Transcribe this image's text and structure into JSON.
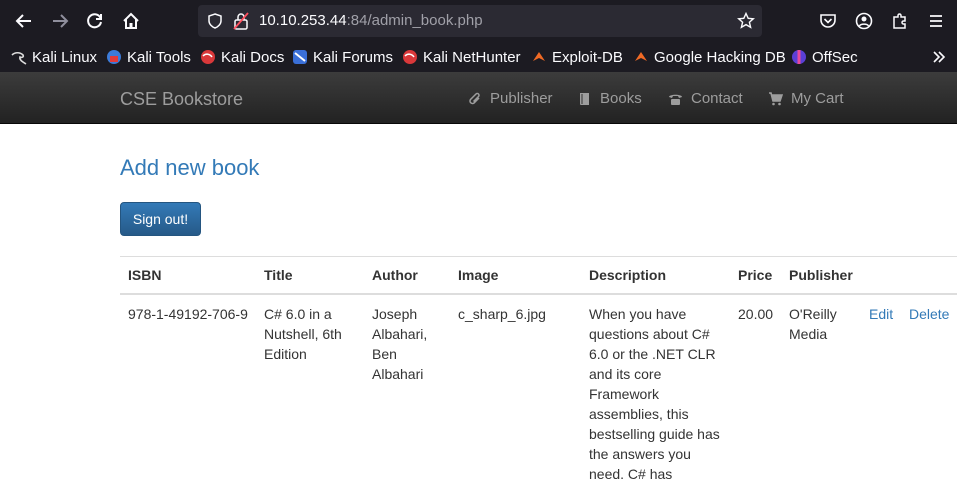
{
  "browser": {
    "url_host": "10.10.253.44",
    "url_path": ":84/admin_book.php",
    "bookmarks": [
      {
        "label": "Kali Linux",
        "icon": "kali-dragon-icon"
      },
      {
        "label": "Kali Tools",
        "icon": "kali-tools-icon"
      },
      {
        "label": "Kali Docs",
        "icon": "kali-docs-icon"
      },
      {
        "label": "Kali Forums",
        "icon": "kali-forums-icon"
      },
      {
        "label": "Kali NetHunter",
        "icon": "kali-nethunter-icon"
      },
      {
        "label": "Exploit-DB",
        "icon": "exploit-db-icon"
      },
      {
        "label": "Google Hacking DB",
        "icon": "ghdb-icon"
      },
      {
        "label": "OffSec",
        "icon": "offsec-icon"
      }
    ]
  },
  "navbar": {
    "brand": "CSE Bookstore",
    "items": [
      {
        "label": "Publisher",
        "icon": "paperclip-icon"
      },
      {
        "label": "Books",
        "icon": "book-icon"
      },
      {
        "label": "Contact",
        "icon": "phone-icon"
      },
      {
        "label": "My Cart",
        "icon": "cart-icon"
      }
    ]
  },
  "main": {
    "heading": "Add new book",
    "signout_label": "Sign out!",
    "table": {
      "headers": [
        "ISBN",
        "Title",
        "Author",
        "Image",
        "Description",
        "Price",
        "Publisher"
      ],
      "rows": [
        {
          "isbn": "978-1-49192-706-9",
          "title_lines": [
            "C# 6.0 in a",
            "Nutshell, 6th",
            "Edition"
          ],
          "author_lines": [
            "Joseph",
            "Albahari,",
            "Ben",
            "Albahari"
          ],
          "image": "c_sharp_6.jpg",
          "description_lines": [
            "When you have",
            "questions about C#",
            "6.0 or the .NET CLR",
            "and its core",
            "Framework",
            "assemblies, this",
            "bestselling guide has",
            "the answers you",
            "need. C# has"
          ],
          "price": "20.00",
          "publisher_lines": [
            "O'Reilly",
            "Media"
          ],
          "edit_label": "Edit",
          "delete_label": "Delete"
        }
      ]
    }
  },
  "colors": {
    "link": "#337ab7",
    "navbar": "#222222",
    "browser_chrome": "#1c1b22"
  }
}
